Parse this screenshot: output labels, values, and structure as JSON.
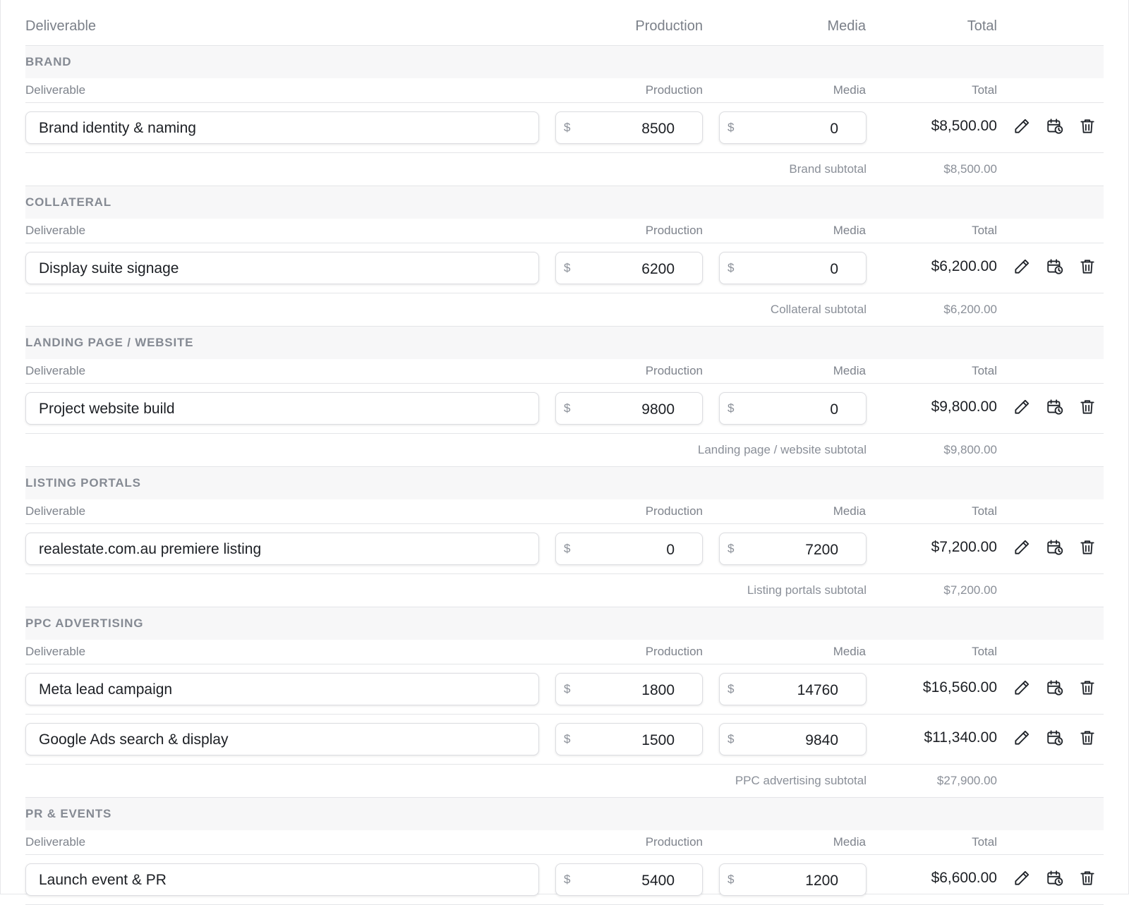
{
  "header": {
    "deliverable": "Deliverable",
    "production": "Production",
    "media": "Media",
    "total": "Total"
  },
  "currency_symbol": "$",
  "icons": [
    "pencil-icon",
    "calendar-clock-icon",
    "trash-icon"
  ],
  "sections": [
    {
      "title": "BRAND",
      "columns": {
        "deliverable": "Deliverable",
        "production": "Production",
        "media": "Media",
        "total": "Total"
      },
      "rows": [
        {
          "name": "Brand identity & naming",
          "production": "8500",
          "media": "0",
          "total": "$8,500.00"
        }
      ],
      "subtotal_label": "Brand subtotal",
      "subtotal_value": "$8,500.00"
    },
    {
      "title": "COLLATERAL",
      "columns": {
        "deliverable": "Deliverable",
        "production": "Production",
        "media": "Media",
        "total": "Total"
      },
      "rows": [
        {
          "name": "Display suite signage",
          "production": "6200",
          "media": "0",
          "total": "$6,200.00"
        }
      ],
      "subtotal_label": "Collateral subtotal",
      "subtotal_value": "$6,200.00"
    },
    {
      "title": "LANDING PAGE / WEBSITE",
      "columns": {
        "deliverable": "Deliverable",
        "production": "Production",
        "media": "Media",
        "total": "Total"
      },
      "rows": [
        {
          "name": "Project website build",
          "production": "9800",
          "media": "0",
          "total": "$9,800.00"
        }
      ],
      "subtotal_label": "Landing page / website subtotal",
      "subtotal_value": "$9,800.00"
    },
    {
      "title": "LISTING PORTALS",
      "columns": {
        "deliverable": "Deliverable",
        "production": "Production",
        "media": "Media",
        "total": "Total"
      },
      "rows": [
        {
          "name": "realestate.com.au premiere listing",
          "production": "0",
          "media": "7200",
          "total": "$7,200.00"
        }
      ],
      "subtotal_label": "Listing portals subtotal",
      "subtotal_value": "$7,200.00"
    },
    {
      "title": "PPC ADVERTISING",
      "columns": {
        "deliverable": "Deliverable",
        "production": "Production",
        "media": "Media",
        "total": "Total"
      },
      "rows": [
        {
          "name": "Meta lead campaign",
          "production": "1800",
          "media": "14760",
          "total": "$16,560.00"
        },
        {
          "name": "Google Ads search & display",
          "production": "1500",
          "media": "9840",
          "total": "$11,340.00"
        }
      ],
      "subtotal_label": "PPC advertising subtotal",
      "subtotal_value": "$27,900.00"
    },
    {
      "title": "PR & EVENTS",
      "columns": {
        "deliverable": "Deliverable",
        "production": "Production",
        "media": "Media",
        "total": "Total"
      },
      "rows": [
        {
          "name": "Launch event & PR",
          "production": "5400",
          "media": "1200",
          "total": "$6,600.00"
        }
      ],
      "subtotal_label": "",
      "subtotal_value": ""
    }
  ]
}
